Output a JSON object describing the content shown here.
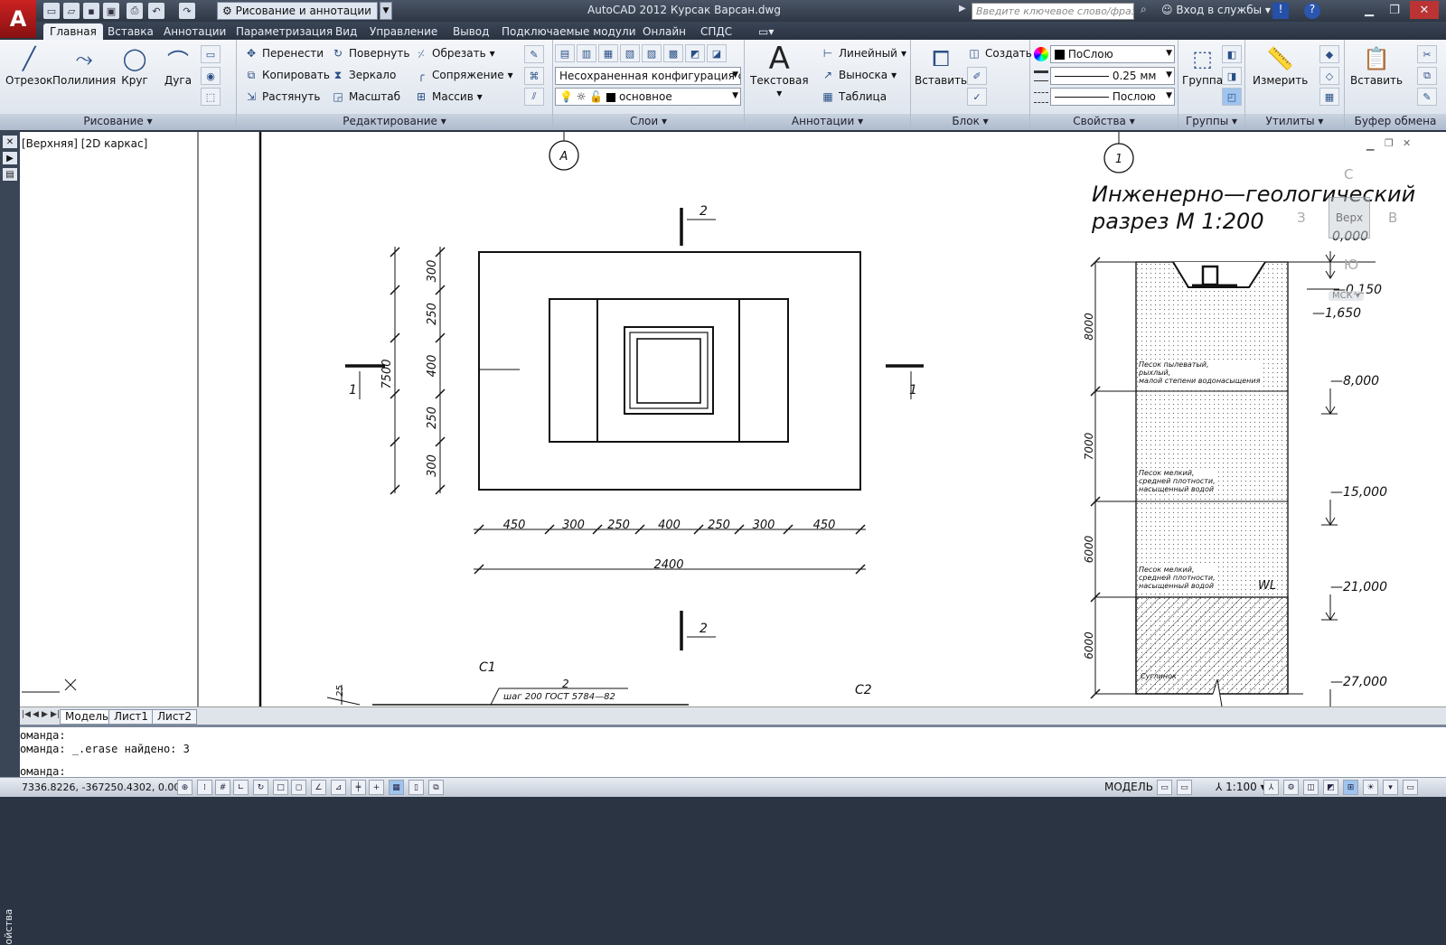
{
  "app": {
    "title": "AutoCAD 2012   Курсак Варсан.dwg",
    "workspace": "Рисование и аннотации",
    "search_placeholder": "Введите ключевое слово/фразу",
    "login": "Вход в службы"
  },
  "ribbon_tabs": [
    "Главная",
    "Вставка",
    "Аннотации",
    "Параметризация",
    "Вид",
    "Управление",
    "Вывод",
    "Подключаемые модули",
    "Онлайн",
    "СПДС"
  ],
  "draw_panel": {
    "label": "Рисование",
    "tools": [
      "Отрезок",
      "Полилиния",
      "Круг",
      "Дуга"
    ]
  },
  "modify_panel": {
    "label": "Редактирование",
    "tools": [
      "Перенести",
      "Повернуть",
      "Обрезать",
      "Копировать",
      "Зеркало",
      "Сопряжение",
      "Растянуть",
      "Масштаб",
      "Массив"
    ]
  },
  "layers_panel": {
    "label": "Слои",
    "config": "Несохраненная конфигурация сло",
    "current_layer": "основное"
  },
  "annotation_panel": {
    "label": "Аннотации",
    "big": "Текстовая",
    "tools": [
      "Линейный",
      "Выноска",
      "Таблица"
    ]
  },
  "block_panel": {
    "label": "Блок",
    "big": "Вставить",
    "create": "Создать"
  },
  "properties_panel": {
    "label": "Свойства",
    "color": "ПоСлою",
    "lineweight": "0.25 мм",
    "linetype": "Послою"
  },
  "groups_panel": {
    "label": "Группы",
    "big": "Группа"
  },
  "utilities_panel": {
    "label": "Утилиты",
    "big": "Измерить"
  },
  "clipboard_panel": {
    "label": "Буфер обмена",
    "big": "Вставить"
  },
  "viewport_label": "[Верхняя] [2D каркас]",
  "drawing": {
    "axis_a": "A",
    "axis_1": "1",
    "section_2": "2",
    "section_1": "1",
    "vert_dims": [
      "300",
      "250",
      "400",
      "250",
      "300"
    ],
    "vert_total": "7500",
    "horiz_dims": [
      "450",
      "300",
      "250",
      "400",
      "250",
      "300",
      "450"
    ],
    "horiz_total": "2400",
    "c1": "C1",
    "c2": "C2",
    "rebar_top": "2",
    "rebar_bottom": "шаг 200  ГОСТ 5784—82",
    "dim_25": "25",
    "geo_title_1": "Инженерно—геологический",
    "geo_title_2": "разрез  М 1:200",
    "layer_depths": [
      "8000",
      "7000",
      "6000",
      "6000"
    ],
    "elevations": [
      "0,000",
      "—0,150",
      "—1,650",
      "—8,000",
      "—15,000",
      "—21,000",
      "—27,000"
    ],
    "soil_1": [
      "Песок пылеватый,",
      "рыхлый,",
      "малой степени водонасыщения"
    ],
    "soil_2": [
      "Песок мелкий,",
      "средней плотности,",
      "насыщенный водой"
    ],
    "soil_3": [
      "Песок мелкий,",
      "средней плотности,",
      "насыщенный водой"
    ],
    "soil_4": "Суглинок",
    "wl": "WL",
    "viewcube": {
      "top": "Верх",
      "n": "С",
      "w": "З",
      "e": "В",
      "s": "Ю",
      "ucs": "МСК"
    }
  },
  "layout_tabs": [
    "Модель",
    "Лист1",
    "Лист2"
  ],
  "command_lines": [
    "оманда:",
    "оманда: _.erase найдено: 3",
    "оманда:"
  ],
  "status": {
    "coords": "7336.8226, -367250.4302, 0.0000",
    "model": "МОДЕЛЬ",
    "scale": "1:100"
  },
  "palette_label": "ойства"
}
